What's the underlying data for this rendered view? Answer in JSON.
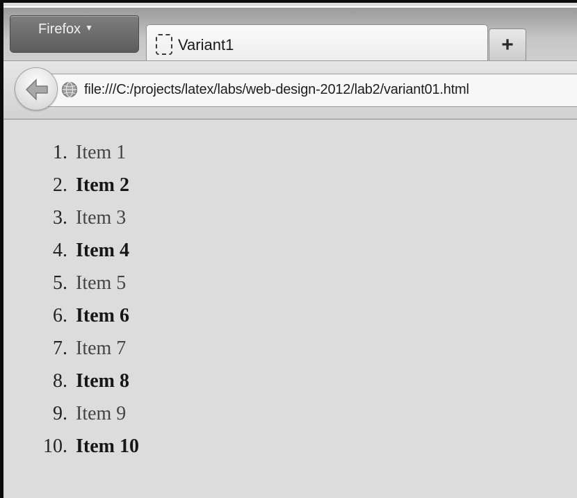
{
  "browser": {
    "menu_button_label": "Firefox",
    "menu_caret": "▼",
    "tab": {
      "title": "Variant1",
      "favicon": "blank-page-icon"
    },
    "new_tab_label": "+",
    "url": "file:///C:/projects/latex/labs/web-design-2012/lab2/variant01.html"
  },
  "page": {
    "ordered_list": [
      {
        "number": "1.",
        "label": "Item 1",
        "style": "regular"
      },
      {
        "number": "2.",
        "label": "Item 2",
        "style": "bold"
      },
      {
        "number": "3.",
        "label": "Item 3",
        "style": "regular"
      },
      {
        "number": "4.",
        "label": "Item 4",
        "style": "bold"
      },
      {
        "number": "5.",
        "label": "Item 5",
        "style": "regular"
      },
      {
        "number": "6.",
        "label": "Item 6",
        "style": "bold"
      },
      {
        "number": "7.",
        "label": "Item 7",
        "style": "regular"
      },
      {
        "number": "8.",
        "label": "Item 8",
        "style": "bold"
      },
      {
        "number": "9.",
        "label": "Item 9",
        "style": "regular"
      },
      {
        "number": "10.",
        "label": "Item 10",
        "style": "bold"
      }
    ]
  },
  "icons": {
    "back": "back-arrow-icon",
    "site_identity": "globe-icon",
    "tab_favicon": "blank-page-icon"
  },
  "colors": {
    "chrome_dark": "#5c5c5c",
    "page_background": "#dcdcdc",
    "frame": "#0c0c0c"
  }
}
